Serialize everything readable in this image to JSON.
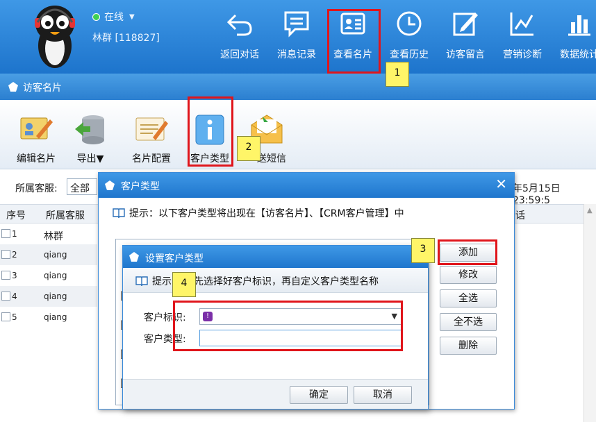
{
  "header": {
    "status": "在线",
    "user": "林群 [118827]",
    "nav": [
      {
        "label": "返回对话",
        "icon": "undo-arrow-icon"
      },
      {
        "label": "消息记录",
        "icon": "chat-bubble-icon"
      },
      {
        "label": "查看名片",
        "icon": "id-card-icon"
      },
      {
        "label": "查看历史",
        "icon": "clock-icon"
      },
      {
        "label": "访客留言",
        "icon": "edit-note-icon"
      },
      {
        "label": "营销诊断",
        "icon": "trend-chart-icon"
      },
      {
        "label": "数据统计",
        "icon": "bar-chart-icon"
      }
    ]
  },
  "section": {
    "title": "访客名片"
  },
  "toolbar": {
    "items": [
      {
        "label": "编辑名片",
        "icon": "edit-card-icon"
      },
      {
        "label": "导出▼",
        "icon": "database-export-icon"
      },
      {
        "label": "名片配置",
        "icon": "card-config-icon"
      },
      {
        "label": "客户类型",
        "icon": "info-icon"
      },
      {
        "label": "送短信",
        "icon": "envelope-sms-icon"
      }
    ]
  },
  "filter": {
    "label": "所属客服:",
    "value": "全部",
    "date_text": "年5月15日 23:59:5"
  },
  "table": {
    "headers": [
      "序号",
      "所属客服",
      "话"
    ],
    "rows": [
      {
        "no": "1",
        "service": "林群"
      },
      {
        "no": "2",
        "service": "qiang"
      },
      {
        "no": "3",
        "service": "qiang"
      },
      {
        "no": "4",
        "service": "qiang"
      },
      {
        "no": "5",
        "service": "qiang"
      }
    ]
  },
  "dialog": {
    "title": "客户类型",
    "hint": "提示：以下客户类型将出现在【访客名片】、【CRM客户管理】中",
    "buttons": [
      "添加",
      "修改",
      "全选",
      "全不选",
      "删除"
    ]
  },
  "subdialog": {
    "title": "设置客户类型",
    "hint_prefix": "提示",
    "hint_rest": "先选择好客户标识，再自定义客户类型名称",
    "field_icon_label": "客户标识:",
    "field_type_label": "客户类型:",
    "field_type_value": "",
    "confirm": "确定",
    "cancel": "取消"
  },
  "annotations": [
    "1",
    "2",
    "3",
    "4"
  ],
  "colors": {
    "header_blue": "#2a82d8",
    "highlight_red": "#e0151b",
    "tag_yellow": "#fff568"
  }
}
